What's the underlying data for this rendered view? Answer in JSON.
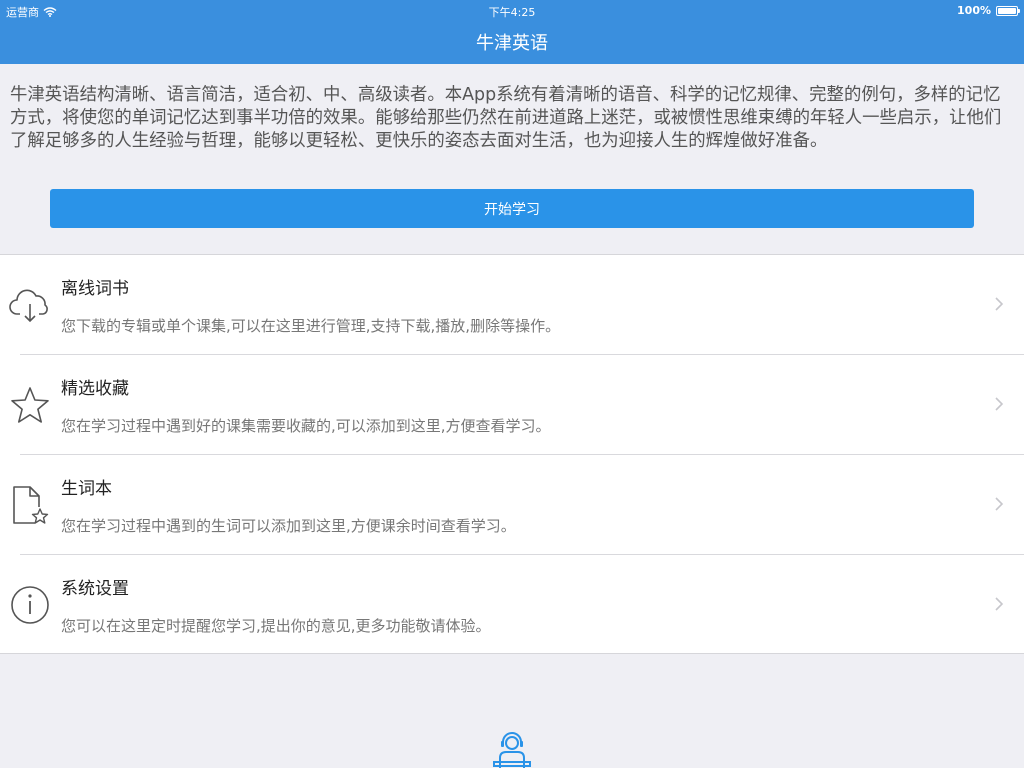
{
  "status_bar": {
    "carrier": "运营商",
    "wifi_icon": "wifi-icon",
    "time": "下午4:25",
    "battery": "100%",
    "battery_level": 1.0
  },
  "nav": {
    "title": "牛津英语"
  },
  "intro": {
    "text": "牛津英语结构清晰、语言简洁，适合初、中、高级读者。本App系统有着清晰的语音、科学的记忆规律、完整的例句，多样的记忆方式，将使您的单词记忆达到事半功倍的效果。能够给那些仍然在前进道路上迷茫，或被惯性思维束缚的年轻人一些启示，让他们了解足够多的人生经验与哲理，能够以更轻松、更快乐的姿态去面对生活，也为迎接人生的辉煌做好准备。",
    "start_button": "开始学习"
  },
  "menu": {
    "items": [
      {
        "icon": "cloud-download-icon",
        "title": "离线词书",
        "desc": "您下载的专辑或单个课集,可以在这里进行管理,支持下载,播放,删除等操作。"
      },
      {
        "icon": "star-icon",
        "title": "精选收藏",
        "desc": "您在学习过程中遇到好的课集需要收藏的,可以添加到这里,方便查看学习。"
      },
      {
        "icon": "document-star-icon",
        "title": "生词本",
        "desc": "您在学习过程中遇到的生词可以添加到这里,方便课余时间查看学习。"
      },
      {
        "icon": "info-icon",
        "title": "系统设置",
        "desc": "您可以在这里定时提醒您学习,提出你的意见,更多功能敬请体验。"
      }
    ]
  },
  "bottom": {
    "logo_icon": "headset-person-icon"
  },
  "colors": {
    "accent": "#3a8fde",
    "button": "#2a93e8",
    "background": "#efeff4"
  }
}
